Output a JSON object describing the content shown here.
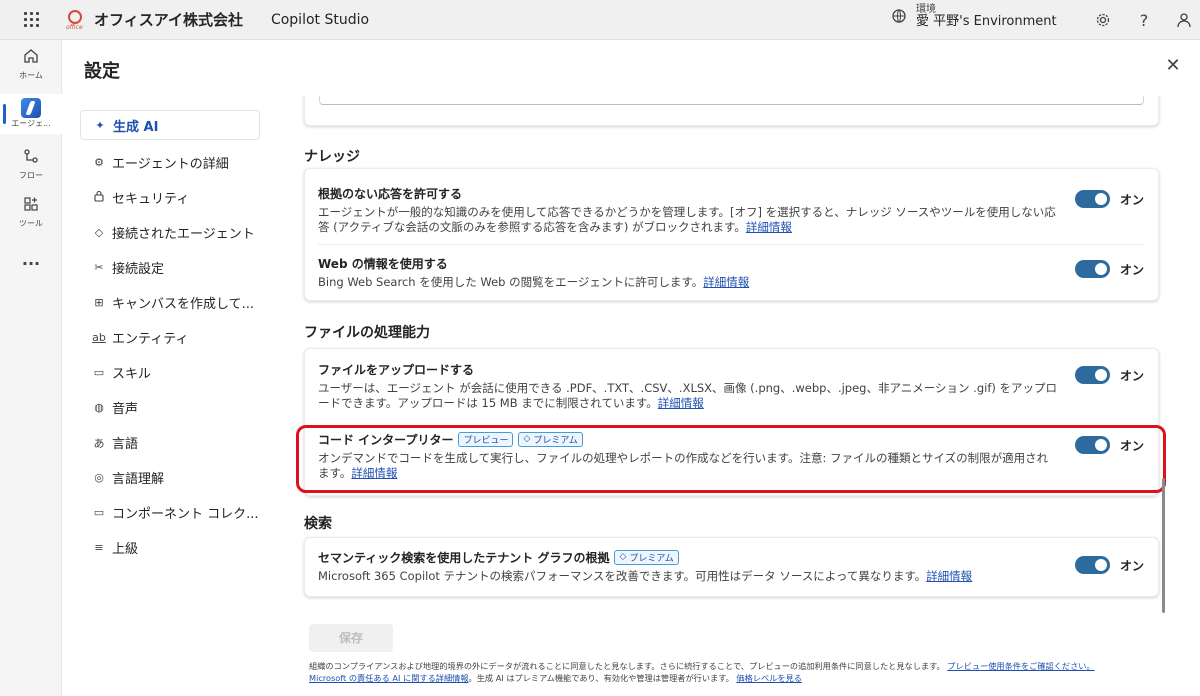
{
  "topbar": {
    "company": "オフィスアイ株式会社",
    "logo_small": "office",
    "app_name": "Copilot Studio",
    "env_label": "環境",
    "env_name": "愛 平野's Environment"
  },
  "rail": [
    {
      "label": "ホーム",
      "icon": "home-icon"
    },
    {
      "label": "エージェ...",
      "icon": "agent-icon"
    },
    {
      "label": "フロー",
      "icon": "flow-icon"
    },
    {
      "label": "ツール",
      "icon": "tools-icon"
    },
    {
      "label": "...",
      "icon": "more-icon"
    }
  ],
  "page": {
    "title": "設定",
    "close": "✕"
  },
  "nav": [
    {
      "label": "生成 AI",
      "icon": "✦"
    },
    {
      "label": "エージェントの詳細",
      "icon": "⚙"
    },
    {
      "label": "セキュリティ",
      "icon": "🔒"
    },
    {
      "label": "接続されたエージェント",
      "icon": "◇"
    },
    {
      "label": "接続設定",
      "icon": "✂"
    },
    {
      "label": "キャンバスを作成して...",
      "icon": "⊞"
    },
    {
      "label": "エンティティ",
      "icon": "ab"
    },
    {
      "label": "スキル",
      "icon": "▭"
    },
    {
      "label": "音声",
      "icon": "◍"
    },
    {
      "label": "言語",
      "icon": "あ"
    },
    {
      "label": "言語理解",
      "icon": "◎"
    },
    {
      "label": "コンポーネント コレク...",
      "icon": "▭"
    },
    {
      "label": "上級",
      "icon": "≡"
    }
  ],
  "sections": {
    "knowledge": {
      "heading": "ナレッジ",
      "rows": [
        {
          "title": "根拠のない応答を許可する",
          "desc": "エージェントが一般的な知識のみを使用して応答できるかどうかを管理します。[オフ] を選択すると、ナレッジ ソースやツールを使用しない応答 (アクティブな会話の文脈のみを参照する応答を含みます) がブロックされます。",
          "link": "詳細情報",
          "toggle": "オン"
        },
        {
          "title": "Web の情報を使用する",
          "desc": "Bing Web Search を使用した Web の閲覧をエージェントに許可します。",
          "link": "詳細情報",
          "toggle": "オン"
        }
      ]
    },
    "files": {
      "heading": "ファイルの処理能力",
      "rows": [
        {
          "title": "ファイルをアップロードする",
          "desc": "ユーザーは、エージェント が会話に使用できる .PDF、.TXT、.CSV、.XLSX、画像 (.png、.webp、.jpeg、非アニメーション .gif) をアップロードできます。アップロードは 15 MB までに制限されています。",
          "link": "詳細情報",
          "toggle": "オン"
        },
        {
          "title": "コード インタープリター",
          "badge_preview": "プレビュー",
          "badge_premium": "プレミアム",
          "desc": "オンデマンドでコードを生成して実行し、ファイルの処理やレポートの作成などを行います。注意: ファイルの種類とサイズの制限が適用されます。",
          "link": "詳細情報",
          "toggle": "オン"
        }
      ]
    },
    "search": {
      "heading": "検索",
      "rows": [
        {
          "title": "セマンティック検索を使用したテナント グラフの根拠",
          "badge_premium": "プレミアム",
          "desc": "Microsoft 365 Copilot テナントの検索パフォーマンスを改善できます。可用性はデータ ソースによって異なります。",
          "link": "詳細情報",
          "toggle": "オン"
        }
      ]
    }
  },
  "footer": {
    "save": "保存",
    "text1": "組織のコンプライアンスおよび地理的境界の外にデータが流れることに同意したと見なします。さらに続行することで、プレビューの追加利用条件に同意したと見なします。",
    "link1": "プレビュー使用条件をご確認ください。",
    "link2": "Microsoft の責任ある AI に関する詳細情報",
    "text2": "。生成 AI はプレミアム機能であり、有効化や管理は管理者が行います。",
    "link3": "価格レベルを見る"
  }
}
